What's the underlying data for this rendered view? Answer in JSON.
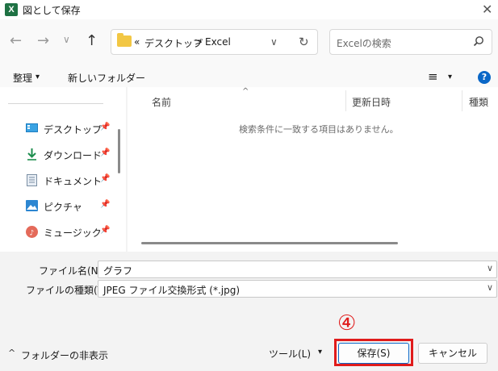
{
  "window": {
    "title": "図として保存",
    "app_icon": "X"
  },
  "nav": {
    "back": "←",
    "forward": "→",
    "recent": "∨",
    "up": "↑",
    "address_prefix": "«",
    "path": [
      "デスクトップ",
      "Excel"
    ],
    "sep": ">",
    "address_chevron": "∨",
    "refresh": "↻",
    "search_placeholder": "Excelの検索"
  },
  "toolbar": {
    "organize": "整理",
    "organize_arrow": "▾",
    "new_folder": "新しいフォルダー",
    "view_icon": "≡",
    "view_arrow": "▾",
    "help": "?"
  },
  "sidebar": {
    "items": [
      {
        "label": "デスクトップ",
        "icon": "desktop-icon"
      },
      {
        "label": "ダウンロード",
        "icon": "download-icon"
      },
      {
        "label": "ドキュメント",
        "icon": "document-icon"
      },
      {
        "label": "ピクチャ",
        "icon": "pictures-icon"
      },
      {
        "label": "ミュージック",
        "icon": "music-icon"
      }
    ],
    "pin": "📌"
  },
  "content": {
    "columns": [
      "名前",
      "更新日時",
      "種類"
    ],
    "sort_indicator": "^",
    "empty_message": "検索条件に一致する項目はありません。"
  },
  "form": {
    "filename_label": "ファイル名(N):",
    "filename_value": "グラフ",
    "filetype_label": "ファイルの種類(T):",
    "filetype_value": "JPEG ファイル交換形式 (*.jpg)",
    "chev": "∨"
  },
  "footer": {
    "hide_folders": "フォルダーの非表示",
    "hide_arrow": "^",
    "tools": "ツール(L)",
    "tools_arrow": "▾",
    "save": "保存(S)",
    "cancel": "キャンセル",
    "step_number": "④"
  },
  "colors": {
    "highlight": "#e01b1b",
    "accent": "#0a67c7"
  }
}
